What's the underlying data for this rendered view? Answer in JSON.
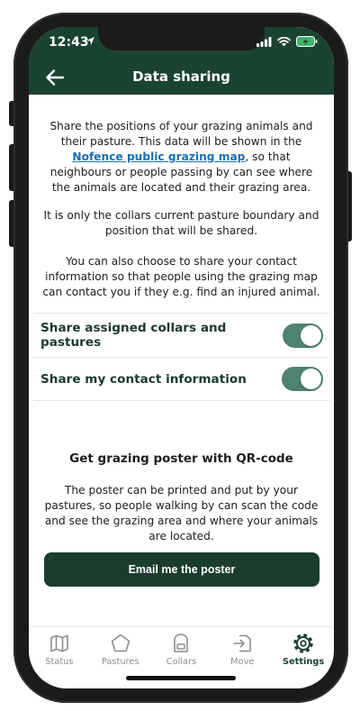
{
  "status_bar": {
    "time": "12:43"
  },
  "header": {
    "title": "Data sharing"
  },
  "intro": {
    "before_link": "Share the positions of your grazing animals and their pasture. This data will be shown in the ",
    "link": "Nofence public grazing map",
    "after_link": ", so that neighbours or people passing by can see where the animals are located and their grazing area."
  },
  "collars_note": "It is only the collars current pasture boundary and position that will be shared.",
  "contact_note": "You can also choose to share your contact information so that people using the grazing map can contact you if they e.g. find an injured animal.",
  "settings": [
    {
      "label": "Share assigned collars and pastures",
      "enabled": true
    },
    {
      "label": "Share my contact information",
      "enabled": true
    }
  ],
  "poster": {
    "title": "Get grazing poster with QR-code",
    "description": "The poster can be printed and put by your pastures, so people walking by can scan the code and see the grazing area and where your animals are located.",
    "button": "Email me the poster"
  },
  "tabs": [
    {
      "label": "Status",
      "icon": "map-icon"
    },
    {
      "label": "Pastures",
      "icon": "pentagon-icon"
    },
    {
      "label": "Collars",
      "icon": "collar-icon"
    },
    {
      "label": "Move",
      "icon": "move-icon"
    },
    {
      "label": "Settings",
      "icon": "gear-icon",
      "active": true
    }
  ],
  "colors": {
    "header": "#1b4332",
    "toggle_on": "#4f8270",
    "link": "#1a6fb5",
    "button": "#1b3d2e"
  }
}
